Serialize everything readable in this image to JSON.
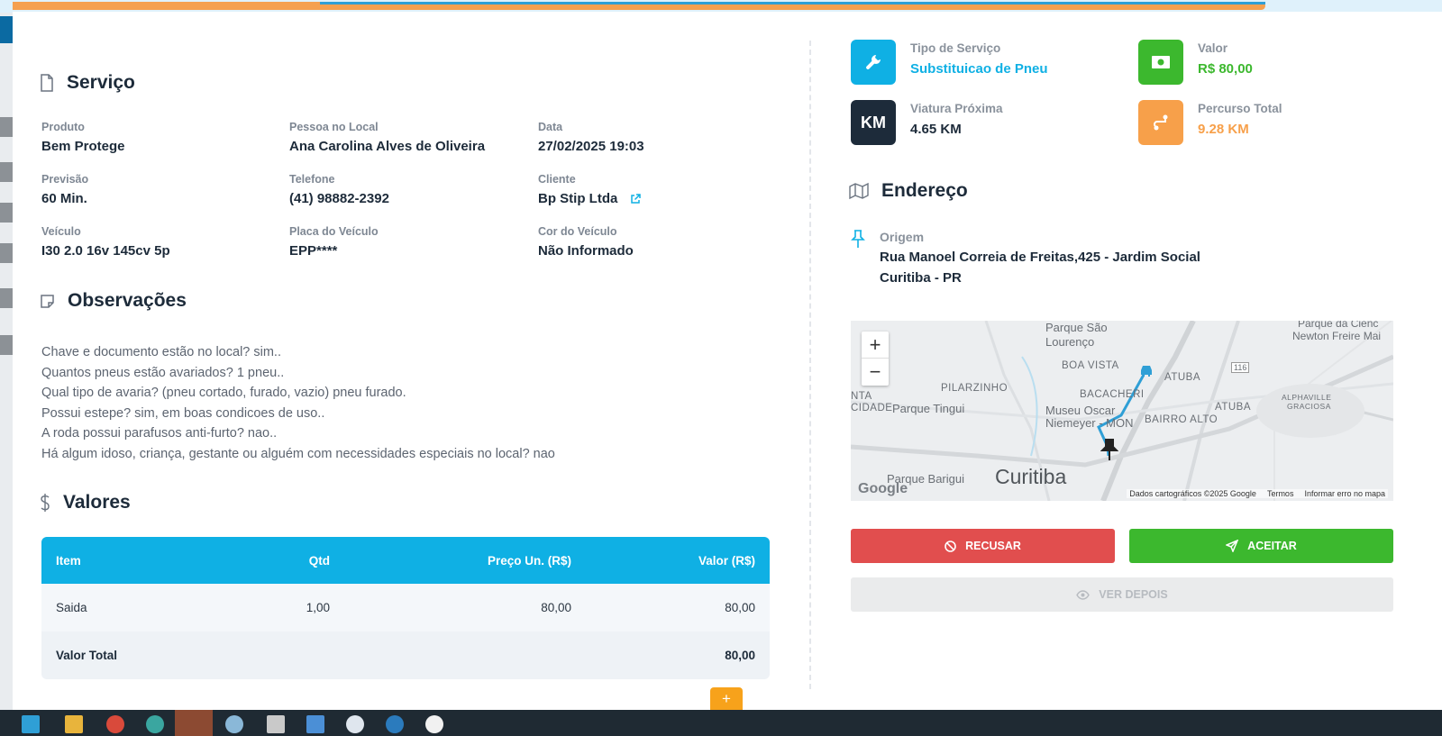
{
  "service": {
    "title": "Serviço",
    "fields": [
      {
        "label": "Produto",
        "value": "Bem Protege"
      },
      {
        "label": "Pessoa no Local",
        "value": "Ana Carolina Alves de Oliveira"
      },
      {
        "label": "Data",
        "value": "27/02/2025 19:03"
      },
      {
        "label": "Previsão",
        "value": "60 Min."
      },
      {
        "label": "Telefone",
        "value": "(41) 98882-2392"
      },
      {
        "label": "Cliente",
        "value": "Bp Stip Ltda"
      },
      {
        "label": "Veículo",
        "value": "I30 2.0 16v 145cv 5p"
      },
      {
        "label": "Placa do Veículo",
        "value": "EPP****"
      },
      {
        "label": "Cor do Veículo",
        "value": "Não Informado"
      }
    ]
  },
  "observations": {
    "title": "Observações",
    "lines": [
      "Chave e documento estão no local? sim..",
      "Quantos pneus estão avariados? 1 pneu..",
      "Qual tipo de avaria? (pneu cortado, furado, vazio) pneu furado.",
      "Possui estepe? sim, em boas condicoes de uso..",
      "A roda possui parafusos anti-furto? nao..",
      "Há algum idoso, criança, gestante ou alguém com necessidades especiais no local? nao"
    ]
  },
  "values": {
    "title": "Valores",
    "headers": {
      "item": "Item",
      "qty": "Qtd",
      "unit": "Preço Un. (R$)",
      "value": "Valor (R$)"
    },
    "rows": [
      {
        "item": "Saida",
        "qty": "1,00",
        "unit": "80,00",
        "value": "80,00"
      }
    ],
    "total_label": "Valor Total",
    "total_value": "80,00"
  },
  "cards": {
    "service_type": {
      "label": "Tipo de Serviço",
      "value": "Substituicao de Pneu",
      "color": "#0fb0e4"
    },
    "price": {
      "label": "Valor",
      "value": "R$ 80,00",
      "color": "#3cb82e"
    },
    "nearest": {
      "label": "Viatura Próxima",
      "value": "4.65 KM",
      "icon_text": "KM",
      "color": "#1d2b3a"
    },
    "route": {
      "label": "Percurso Total",
      "value": "9.28 KM",
      "color": "#f7a04a"
    }
  },
  "address": {
    "title": "Endereço",
    "origin_label": "Origem",
    "line1": "Rua Manoel Correia de Freitas,425 - Jardim Social",
    "line2": "Curitiba - PR"
  },
  "map": {
    "labels": {
      "parque_sao_lourenco_1": "Parque São",
      "parque_sao_lourenco_2": "Lourenço",
      "parque_ciencia_1": "Parque da Ciênc",
      "parque_ciencia_2": "Newton Freire Mai",
      "boa_vista": "BOA VISTA",
      "atuba1": "ATUBA",
      "atuba2": "ATUBA",
      "pilarzinho": "PILARZINHO",
      "bacacheri": "BACACHERI",
      "nta": "NTA",
      "cidade": "CIDADE",
      "parque_tingui": "Parque Tingui",
      "museu1": "Museu Oscar",
      "museu2": "Niemeyer - MON",
      "bairro_alto": "BAIRRO ALTO",
      "alphaville1": "ALPHAVILLE",
      "alphaville2": "GRACIOSA",
      "parque_barigui": "Parque Barigui",
      "curitiba": "Curitiba",
      "road_116": "116"
    },
    "zoom_in": "+",
    "zoom_out": "−",
    "logo": "Google",
    "footer_data": "Dados cartográficos ©2025 Google",
    "footer_terms": "Termos",
    "footer_report": "Informar erro no mapa"
  },
  "actions": {
    "refuse": "RECUSAR",
    "accept": "ACEITAR",
    "later": "VER DEPOIS"
  },
  "fab": "+"
}
